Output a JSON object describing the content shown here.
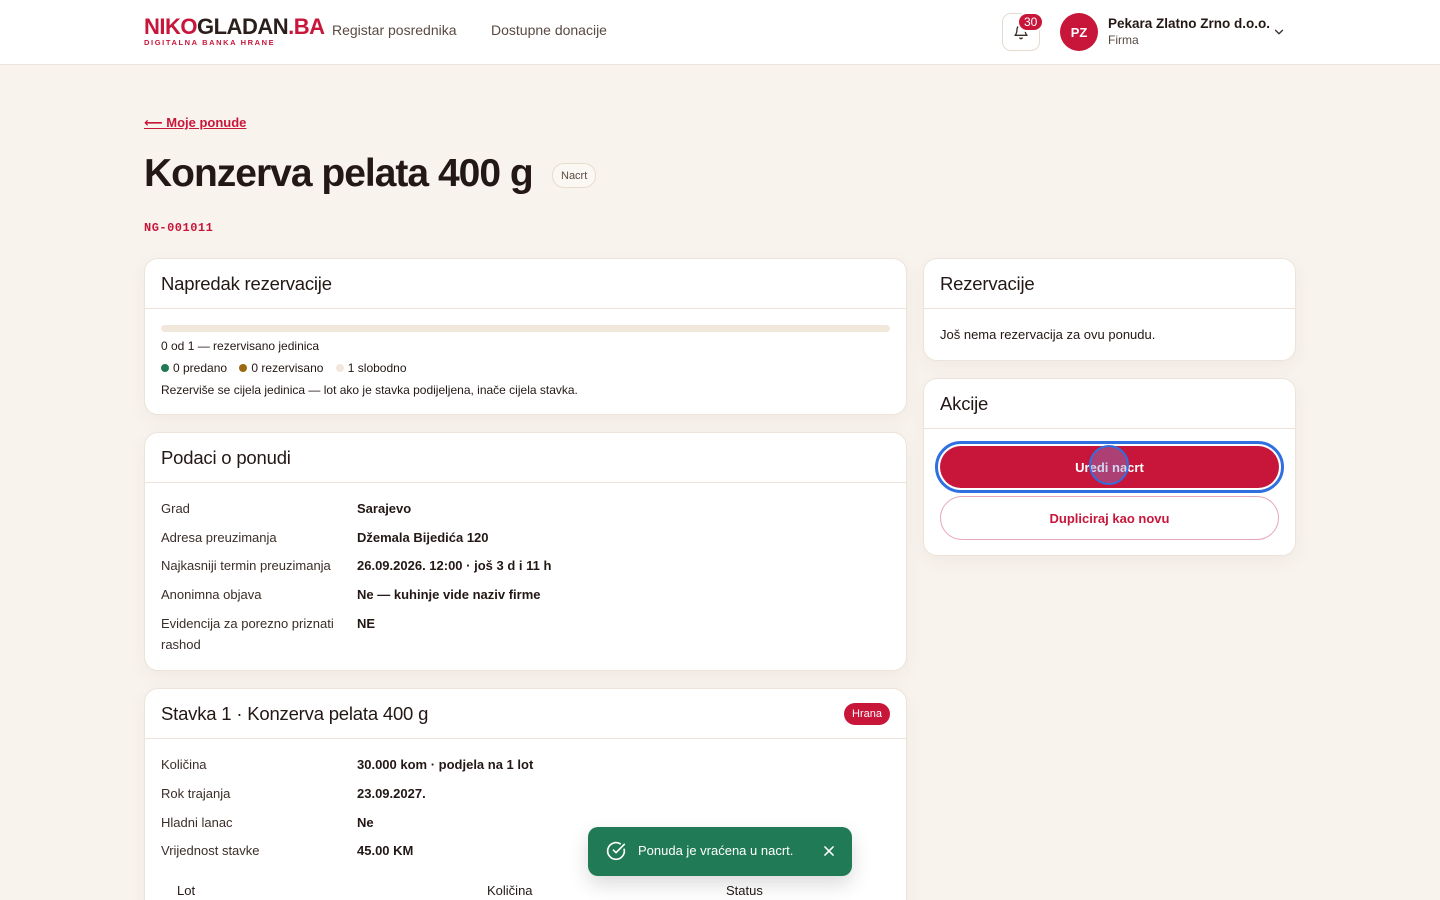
{
  "header": {
    "logo_part1": "NIKO",
    "logo_part2": "GLADAN",
    "logo_part3": ".BA",
    "logo_tagline": "DIGITALNA BANKA HRANE",
    "nav": [
      "Registar posrednika",
      "Dostupne donacije"
    ],
    "notifications_count": "30",
    "user_initials": "PZ",
    "user_name": "Pekara Zlatno Zrno d.o.o.",
    "user_role": "Firma"
  },
  "page": {
    "back_label": "⟵ Moje ponude",
    "title": "Konzerva pelata 400 g",
    "status_badge": "Nacrt",
    "code": "NG-001011"
  },
  "progress": {
    "title": "Napredak rezervacije",
    "fraction_reserved": 0,
    "summary": "0 od 1 — rezervisano jedinica",
    "legend": [
      {
        "label": "0 predano",
        "color": "#1f7a55"
      },
      {
        "label": "0 rezervisano",
        "color": "#9a6a12"
      },
      {
        "label": "1 slobodno",
        "color": "#f1e7da"
      }
    ],
    "note": "Rezerviše se cijela jedinica — lot ako je stavka podijeljena, inače cijela stavka."
  },
  "details": {
    "title": "Podaci o ponudi",
    "rows": [
      {
        "label": "Grad",
        "value": "Sarajevo"
      },
      {
        "label": "Adresa preuzimanja",
        "value": "Džemala Bijedića 120"
      },
      {
        "label": "Najkasniji termin preuzimanja",
        "value": "26.09.2026. 12:00 · još 3 d i 11 h"
      },
      {
        "label": "Anonimna objava",
        "value": "Ne — kuhinje vide naziv firme"
      },
      {
        "label": "Evidencija za porezno priznati rashod",
        "value": "NE"
      }
    ]
  },
  "item": {
    "title": "Stavka 1 · Konzerva pelata 400 g",
    "category_badge": "Hrana",
    "rows": [
      {
        "label": "Količina",
        "value": "30.000 kom · podjela na 1 lot"
      },
      {
        "label": "Rok trajanja",
        "value": "23.09.2027."
      },
      {
        "label": "Hladni lanac",
        "value": "Ne"
      },
      {
        "label": "Vrijednost stavke",
        "value": "45.00 KM"
      }
    ],
    "table_headers": [
      "Lot",
      "Količina",
      "Status"
    ]
  },
  "reservations": {
    "title": "Rezervacije",
    "empty_text": "Još nema rezervacija za ovu ponudu."
  },
  "actions": {
    "title": "Akcije",
    "edit_label": "Uredi nacrt",
    "duplicate_label": "Dupliciraj kao novu"
  },
  "toast": {
    "message": "Ponuda je vraćena u nacrt."
  },
  "colors": {
    "brand": "#c8163b",
    "success": "#1f7a55",
    "background": "#f8f3ed",
    "focus": "#2f6fe0"
  }
}
